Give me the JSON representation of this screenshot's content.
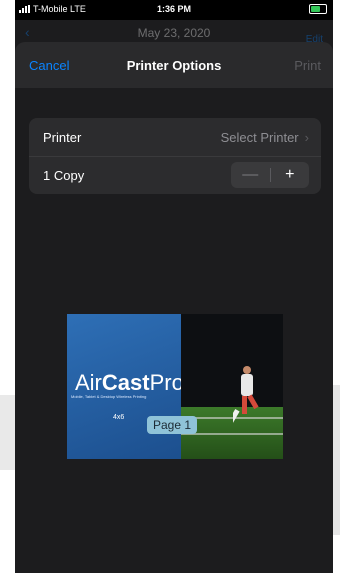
{
  "status": {
    "carrier": "T-Mobile  LTE",
    "time": "1:36 PM"
  },
  "underlying": {
    "date": "May 23, 2020",
    "back_icon": "chevron-left-icon",
    "edit_label": "Edit"
  },
  "nav": {
    "cancel_label": "Cancel",
    "title": "Printer Options",
    "print_label": "Print"
  },
  "options": {
    "printer_label": "Printer",
    "printer_value": "Select Printer",
    "copies_label": "1 Copy",
    "minus": "—",
    "plus": "+"
  },
  "preview": {
    "logo_pre": "Air",
    "logo_bold": "Cast",
    "logo_post": "Pro",
    "tagline": "Mobile, Tablet & Desktop Wireless Printing",
    "size": "4x6",
    "page_label": "Page 1"
  },
  "colors": {
    "accent": "#0a84ff",
    "sheet": "#1c1c1e",
    "group": "#2c2c2e"
  }
}
